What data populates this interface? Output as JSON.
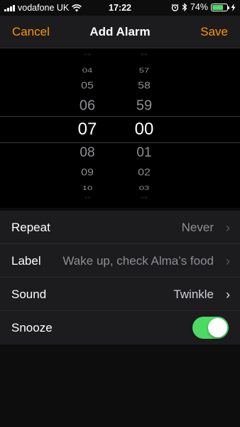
{
  "status_bar": {
    "carrier": "vodafone UK",
    "time": "17:22",
    "battery_percent_label": "74%",
    "battery_level": 0.74,
    "icons": [
      "signal-bars-icon",
      "wifi-icon",
      "alarm-clock-icon",
      "bluetooth-icon",
      "battery-icon",
      "charging-bolt-icon"
    ]
  },
  "nav": {
    "cancel": "Cancel",
    "title": "Add Alarm",
    "save": "Save",
    "accent": "#ff9500"
  },
  "picker": {
    "hours": [
      "03",
      "04",
      "05",
      "06",
      "07",
      "08",
      "09",
      "10",
      "11"
    ],
    "minutes": [
      "56",
      "57",
      "58",
      "59",
      "00",
      "01",
      "02",
      "03",
      "04"
    ],
    "selected_hour": "07",
    "selected_minute": "00"
  },
  "settings": {
    "repeat": {
      "label": "Repeat",
      "value": "Never"
    },
    "alarm_label": {
      "label": "Label",
      "value": "Wake up, check Alma’s food"
    },
    "sound": {
      "label": "Sound",
      "value": "Twinkle"
    },
    "snooze": {
      "label": "Snooze",
      "on": true,
      "toggle_color": "#4cd964"
    }
  }
}
